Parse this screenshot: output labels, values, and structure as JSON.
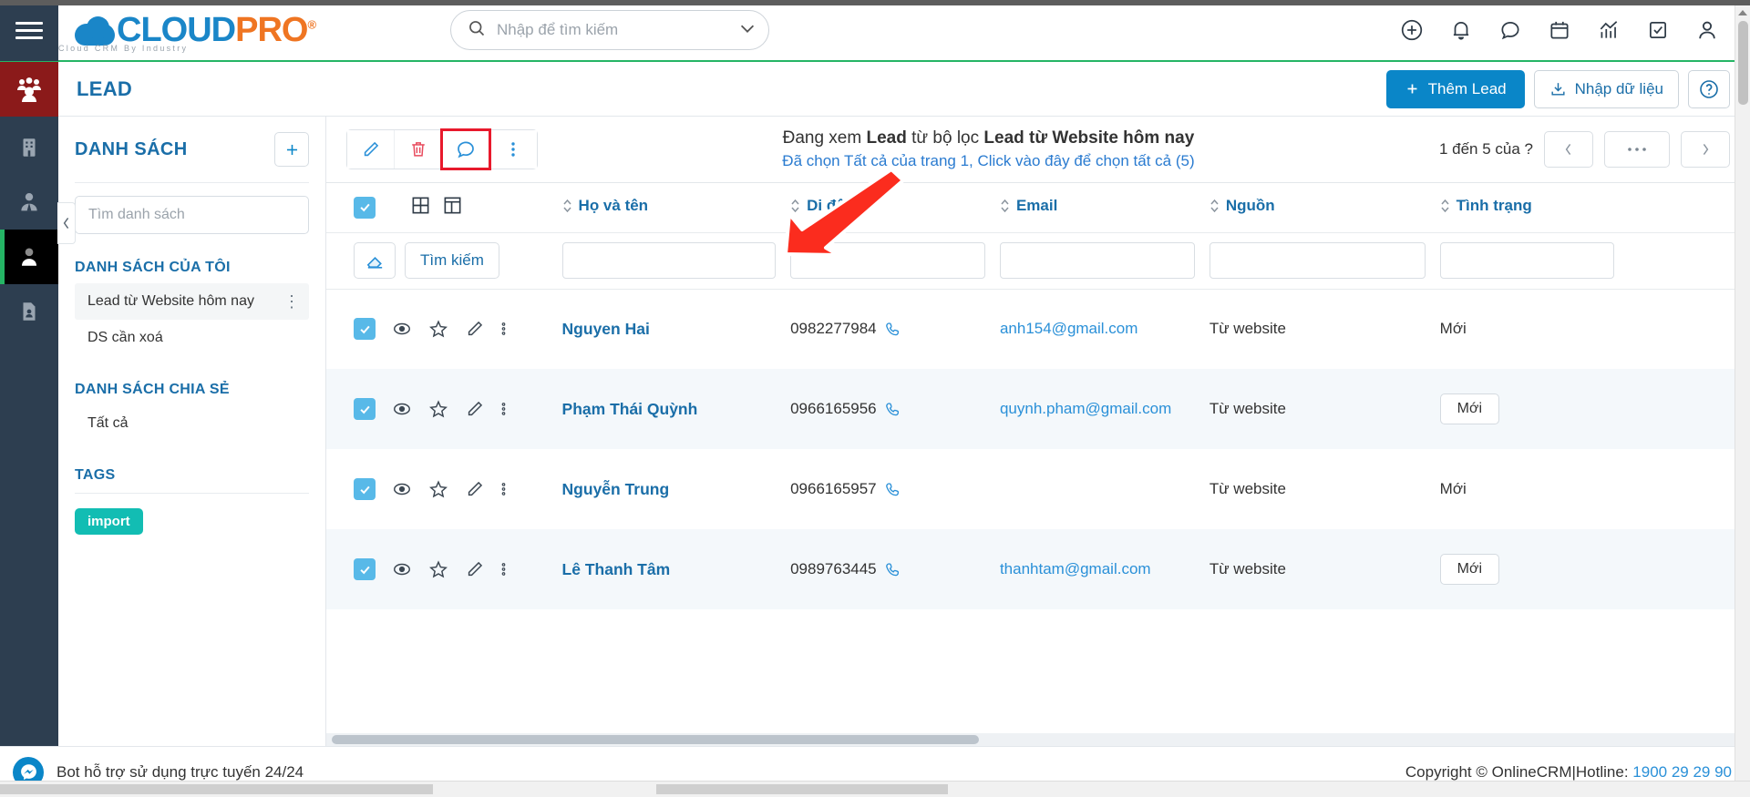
{
  "topbar": {
    "logo_primary": "CLOUD",
    "logo_secondary": "PRO",
    "logo_reg": "®",
    "logo_tagline": "Cloud CRM By Industry",
    "search_placeholder": "Nhập để tìm kiếm",
    "search_value": "",
    "icons": [
      "plus-circle-icon",
      "bell-icon",
      "chat-icon",
      "calendar-icon",
      "chart-icon",
      "task-check-icon",
      "user-icon"
    ]
  },
  "pageheader": {
    "title": "LEAD",
    "add_lead_label": "Thêm Lead",
    "import_label": "Nhập dữ liệu",
    "help_label": "?"
  },
  "sidebar": {
    "panel_title": "DANH SÁCH",
    "add_title": "+",
    "search_placeholder": "Tìm danh sách",
    "search_value": "",
    "group_my": "DANH SÁCH CỦA TÔI",
    "my_items": [
      {
        "label": "Lead từ Website hôm nay",
        "selected": true
      },
      {
        "label": "DS cần xoá",
        "selected": false
      }
    ],
    "group_shared": "DANH SÁCH CHIA SẺ",
    "shared_items": [
      {
        "label": "Tất cả",
        "selected": false
      }
    ],
    "group_tags": "TAGS",
    "tags": [
      {
        "label": "import",
        "color": "#12bdb3"
      }
    ]
  },
  "toolbar": {
    "edit_title": "Sửa",
    "delete_title": "Xoá",
    "comment_title": "Bình luận",
    "more_title": "Thêm",
    "viewing_prefix": "Đang xem",
    "viewing_object": "Lead",
    "viewing_mid": "từ bộ lọc",
    "viewing_filter": "Lead từ Website hôm nay",
    "selection_note": "Đã chọn Tất cả của trang 1, Click vào đây để chọn tất cả (5)",
    "count_text": "1 đến 5 của",
    "count_unknown": "?",
    "prev_label": "‹",
    "more_label": "•••",
    "next_label": "›"
  },
  "table": {
    "columns": [
      "Họ và tên",
      "Di động",
      "Email",
      "Nguồn",
      "Tình trạng"
    ],
    "filter": {
      "clear_title": "Xoá bộ lọc",
      "search_label": "Tìm kiếm",
      "inputs": [
        "",
        "",
        "",
        "",
        ""
      ]
    },
    "rows": [
      {
        "selected": true,
        "name": "Nguyen Hai",
        "mobile": "0982277984",
        "email": "anh154@gmail.com",
        "source": "Từ website",
        "status": "Mới",
        "status_style": "plain"
      },
      {
        "selected": true,
        "name": "Phạm Thái Quỳnh",
        "mobile": "0966165956",
        "email": "quynh.pham@gmail.com",
        "source": "Từ website",
        "status": "Mới",
        "status_style": "chip"
      },
      {
        "selected": true,
        "name": "Nguyễn Trung",
        "mobile": "0966165957",
        "email": "",
        "source": "Từ website",
        "status": "Mới",
        "status_style": "plain"
      },
      {
        "selected": true,
        "name": "Lê Thanh Tâm",
        "mobile": "0989763445",
        "email": "thanhtam@gmail.com",
        "source": "Từ website",
        "status": "Mới",
        "status_style": "chip"
      }
    ]
  },
  "footer": {
    "bot_text": "Bot hỗ trợ sử dụng trực tuyến 24/24",
    "copyright": "Copyright © OnlineCRM",
    "separator": "|",
    "hotline_label": "Hotline:",
    "hotline_number": "1900 29 29 90"
  },
  "colors": {
    "brand_blue": "#0a86c8",
    "brand_orange": "#ef7522",
    "accent_green": "#25b565",
    "rail_dark": "#2d3e50",
    "annotation_red": "#e8192c",
    "tag_teal": "#12bdb3"
  }
}
